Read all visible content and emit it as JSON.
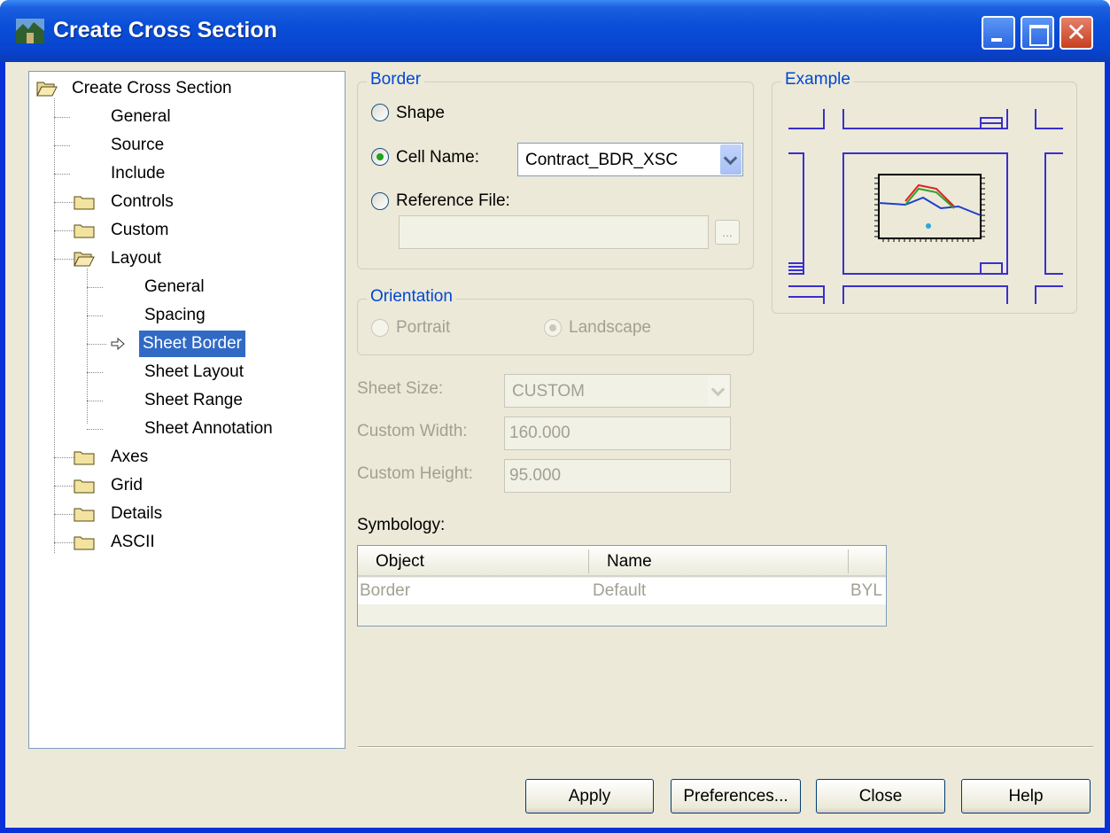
{
  "window": {
    "title": "Create Cross Section",
    "minimize_icon": "minimize-icon",
    "maximize_icon": "maximize-icon",
    "close_icon": "close-icon",
    "close_glyph": "✕"
  },
  "tree": {
    "root": "Create Cross Section",
    "items": [
      "General",
      "Source",
      "Include",
      "Controls",
      "Custom",
      "Layout",
      "General",
      "Spacing",
      "Sheet Border",
      "Sheet Layout",
      "Sheet Range",
      "Sheet Annotation",
      "Axes",
      "Grid",
      "Details",
      "ASCII"
    ],
    "selected": "Sheet Border"
  },
  "border": {
    "title": "Border",
    "shape_label": "Shape",
    "cell_name_label": "Cell Name:",
    "cell_name_value": "Contract_BDR_XSC",
    "reference_file_label": "Reference File:",
    "reference_file_value": "",
    "browse_label": "..."
  },
  "orientation": {
    "title": "Orientation",
    "portrait_label": "Portrait",
    "landscape_label": "Landscape"
  },
  "sheet": {
    "size_label": "Sheet Size:",
    "size_value": "CUSTOM",
    "width_label": "Custom Width:",
    "width_value": "160.000",
    "height_label": "Custom Height:",
    "height_value": "95.000"
  },
  "example": {
    "title": "Example"
  },
  "symbology": {
    "label": "Symbology:",
    "columns": [
      "Object",
      "Name",
      ""
    ],
    "rows": [
      [
        "Border",
        "Default",
        "BYL"
      ]
    ]
  },
  "buttons": {
    "apply": "Apply",
    "preferences": "Preferences...",
    "close": "Close",
    "help": "Help"
  },
  "colors": {
    "titlebar": "#0a4fd8",
    "selection": "#316ac5",
    "group_title": "#0046d5",
    "example_lines": "#3a2fcf"
  }
}
